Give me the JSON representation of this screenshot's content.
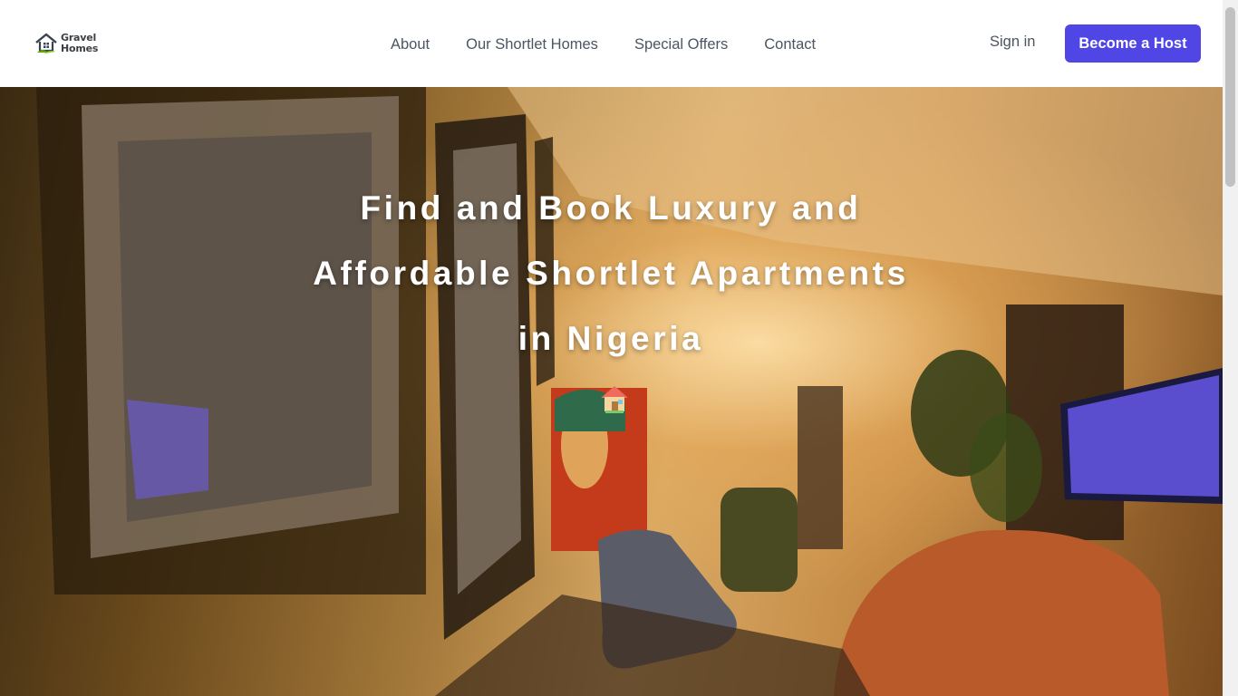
{
  "header": {
    "logo": {
      "line1": "Gravel",
      "line2": "Homes",
      "icon": "house-logo-icon"
    },
    "nav": [
      {
        "label": "About"
      },
      {
        "label": "Our Shortlet Homes"
      },
      {
        "label": "Special Offers"
      },
      {
        "label": "Contact"
      }
    ],
    "sign_in": "Sign in",
    "cta": "Become a Host"
  },
  "hero": {
    "title_lines": [
      "Find and Book Luxury and",
      "Affordable Shortlet Apartments",
      "in Nigeria"
    ],
    "emoji": "🏠",
    "background": "luxury-living-room-photo"
  },
  "colors": {
    "accent": "#4f46e5",
    "nav_text": "#4b5563",
    "hero_text": "#ffffff"
  }
}
